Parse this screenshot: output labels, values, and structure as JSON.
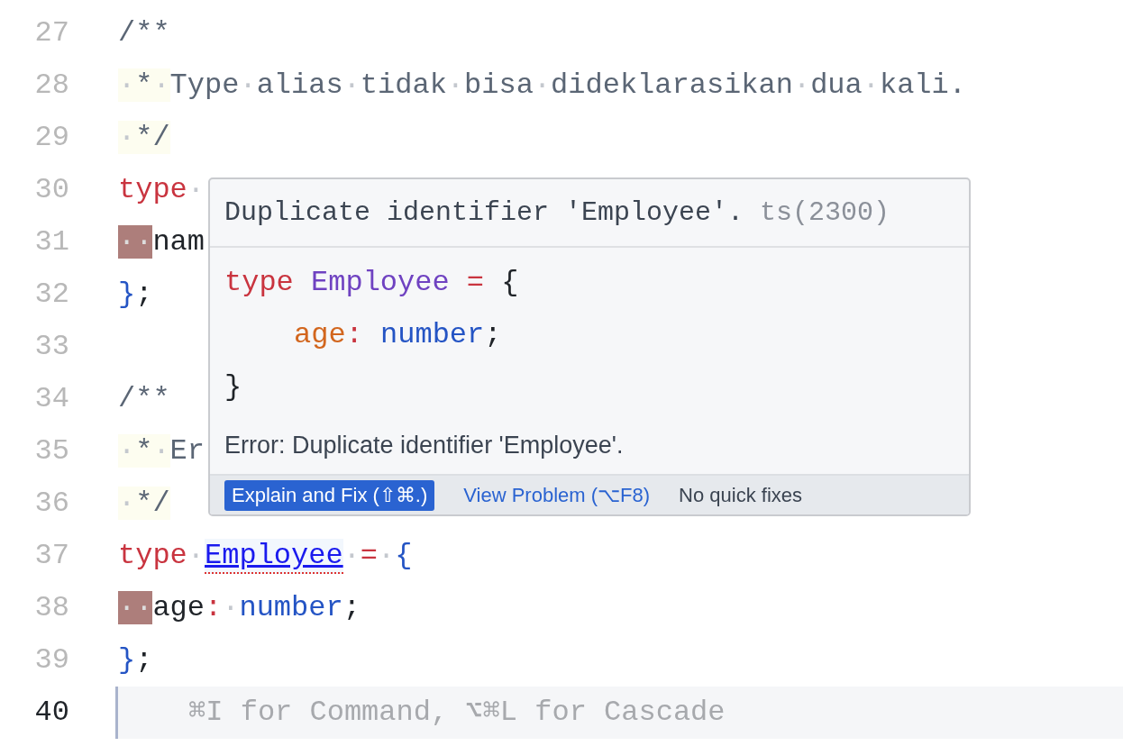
{
  "editor": {
    "lines": [
      {
        "number": "27",
        "current": false,
        "tokens": [
          {
            "kind": "comment",
            "text": "/**"
          }
        ]
      },
      {
        "number": "28",
        "current": false,
        "tokens": [
          {
            "kind": "lead-ws",
            "text": "·"
          },
          {
            "kind": "lead",
            "text": "*"
          },
          {
            "kind": "lead-ws",
            "text": "·"
          },
          {
            "kind": "comment",
            "text": "Type"
          },
          {
            "kind": "ws",
            "text": "·"
          },
          {
            "kind": "comment",
            "text": "alias"
          },
          {
            "kind": "ws",
            "text": "·"
          },
          {
            "kind": "comment",
            "text": "tidak"
          },
          {
            "kind": "ws",
            "text": "·"
          },
          {
            "kind": "comment",
            "text": "bisa"
          },
          {
            "kind": "ws",
            "text": "·"
          },
          {
            "kind": "comment",
            "text": "dideklarasikan"
          },
          {
            "kind": "ws",
            "text": "·"
          },
          {
            "kind": "comment",
            "text": "dua"
          },
          {
            "kind": "ws",
            "text": "·"
          },
          {
            "kind": "comment",
            "text": "kali."
          }
        ]
      },
      {
        "number": "29",
        "current": false,
        "tokens": [
          {
            "kind": "lead-ws",
            "text": "·"
          },
          {
            "kind": "lead",
            "text": "*/"
          }
        ]
      },
      {
        "number": "30",
        "current": false,
        "tokens": [
          {
            "kind": "keyword",
            "text": "type"
          },
          {
            "kind": "ws",
            "text": "·"
          }
        ]
      },
      {
        "number": "31",
        "current": false,
        "tokens": [
          {
            "kind": "indent",
            "text": "··"
          },
          {
            "kind": "plain",
            "text": "nam"
          }
        ]
      },
      {
        "number": "32",
        "current": false,
        "tokens": [
          {
            "kind": "brace",
            "text": "}"
          },
          {
            "kind": "plain",
            "text": ";"
          }
        ]
      },
      {
        "number": "33",
        "current": false
      },
      {
        "number": "34",
        "current": false,
        "tokens": [
          {
            "kind": "comment",
            "text": "/**"
          }
        ]
      },
      {
        "number": "35",
        "current": false,
        "tokens": [
          {
            "kind": "lead-ws",
            "text": "·"
          },
          {
            "kind": "lead",
            "text": "*"
          },
          {
            "kind": "lead-ws",
            "text": "·"
          },
          {
            "kind": "comment",
            "text": "Er"
          }
        ]
      },
      {
        "number": "36",
        "current": false,
        "tokens": [
          {
            "kind": "lead-ws",
            "text": "·"
          },
          {
            "kind": "lead",
            "text": "*/"
          }
        ]
      },
      {
        "number": "37",
        "current": false,
        "tokens": [
          {
            "kind": "keyword",
            "text": "type"
          },
          {
            "kind": "ws",
            "text": "·"
          },
          {
            "kind": "error-ident",
            "text": "Employee"
          },
          {
            "kind": "ws",
            "text": "·"
          },
          {
            "kind": "op",
            "text": "="
          },
          {
            "kind": "ws",
            "text": "·"
          },
          {
            "kind": "brace",
            "text": "{"
          }
        ]
      },
      {
        "number": "38",
        "current": false,
        "tokens": [
          {
            "kind": "indent",
            "text": "··"
          },
          {
            "kind": "plain",
            "text": "age"
          },
          {
            "kind": "op",
            "text": ":"
          },
          {
            "kind": "ws",
            "text": "·"
          },
          {
            "kind": "type",
            "text": "number"
          },
          {
            "kind": "plain",
            "text": ";"
          }
        ]
      },
      {
        "number": "39",
        "current": false,
        "tokens": [
          {
            "kind": "brace",
            "text": "}"
          },
          {
            "kind": "plain",
            "text": ";"
          }
        ]
      },
      {
        "number": "40",
        "current": true,
        "tokens": [
          {
            "kind": "hint",
            "text": "⌘I for Command, ⌥⌘L for Cascade"
          }
        ]
      }
    ]
  },
  "hover": {
    "title": "Duplicate identifier 'Employee'.",
    "code": "ts(2300)",
    "snippet": [
      {
        "indented": false,
        "tokens": [
          {
            "kind": "keyword",
            "text": "type "
          },
          {
            "kind": "typename",
            "text": "Employee"
          },
          {
            "kind": "op",
            "text": " = "
          },
          {
            "kind": "plain",
            "text": "{"
          }
        ]
      },
      {
        "indented": true,
        "tokens": [
          {
            "kind": "prop",
            "text": "age"
          },
          {
            "kind": "op",
            "text": ": "
          },
          {
            "kind": "type",
            "text": "number"
          },
          {
            "kind": "plain",
            "text": ";"
          }
        ]
      },
      {
        "indented": false,
        "tokens": [
          {
            "kind": "plain",
            "text": "}"
          }
        ]
      }
    ],
    "message": "Error: Duplicate identifier 'Employee'.",
    "actions": [
      {
        "kind": "primary",
        "label": "Explain and Fix (⇧⌘.)"
      },
      {
        "kind": "link",
        "label": "View Problem (⌥F8)"
      },
      {
        "kind": "note",
        "label": "No quick fixes"
      }
    ]
  }
}
